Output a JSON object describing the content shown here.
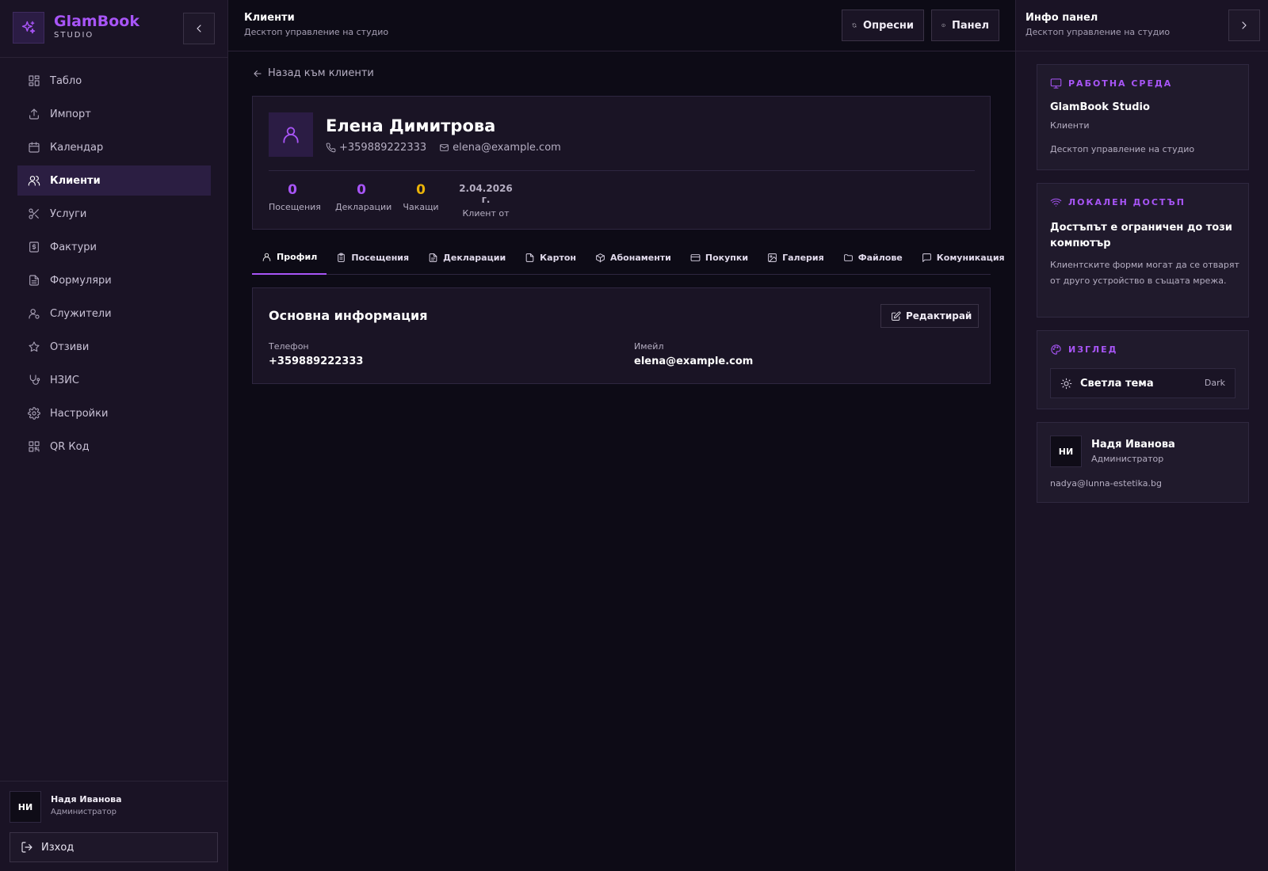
{
  "colors": {
    "accent": "#a855f7",
    "pending": "#eab308",
    "background": "#0d0b16",
    "panel": "#1a1325"
  },
  "sidebar": {
    "brand_name": "GlamBook",
    "brand_sub": "STUDIO",
    "items": [
      {
        "label": "Табло",
        "icon": "dashboard-icon"
      },
      {
        "label": "Импорт",
        "icon": "upload-icon"
      },
      {
        "label": "Календар",
        "icon": "calendar-icon"
      },
      {
        "label": "Клиенти",
        "icon": "users-icon",
        "active": true
      },
      {
        "label": "Услуги",
        "icon": "scissors-icon"
      },
      {
        "label": "Фактури",
        "icon": "invoice-icon"
      },
      {
        "label": "Формуляри",
        "icon": "form-icon"
      },
      {
        "label": "Служители",
        "icon": "staff-icon"
      },
      {
        "label": "Отзиви",
        "icon": "star-icon"
      },
      {
        "label": "НЗИС",
        "icon": "stethoscope-icon"
      },
      {
        "label": "Настройки",
        "icon": "gear-icon"
      },
      {
        "label": "QR Код",
        "icon": "qr-icon"
      }
    ],
    "user": {
      "initials": "НИ",
      "name": "Надя Иванова",
      "role": "Администратор"
    },
    "logout_label": "Изход"
  },
  "header": {
    "title": "Клиенти",
    "subtitle": "Десктоп управление на студио",
    "refresh_label": "Опресни",
    "panel_label": "Панел"
  },
  "main": {
    "back_label": "Назад към клиенти",
    "client": {
      "name": "Елена Димитрова",
      "phone": "+359889222333",
      "email": "elena@example.com",
      "stats": {
        "visits": "0",
        "visits_label": "Посещения",
        "declarations": "0",
        "declarations_label": "Декларации",
        "pending": "0",
        "pending_label": "Чакащи",
        "since": "2.04.2026 г.",
        "since_label": "Клиент от"
      }
    },
    "tabs": [
      {
        "label": "Профил",
        "icon": "user-icon",
        "active": true
      },
      {
        "label": "Посещения",
        "icon": "clipboard-icon"
      },
      {
        "label": "Декларации",
        "icon": "document-icon"
      },
      {
        "label": "Картон",
        "icon": "file-icon"
      },
      {
        "label": "Абонаменти",
        "icon": "package-icon"
      },
      {
        "label": "Покупки",
        "icon": "credit-card-icon"
      },
      {
        "label": "Галерия",
        "icon": "image-icon"
      },
      {
        "label": "Файлове",
        "icon": "folder-icon"
      },
      {
        "label": "Комуникация",
        "icon": "message-icon"
      }
    ],
    "info": {
      "title": "Основна информация",
      "edit_label": "Редактирай",
      "phone_label": "Телефон",
      "phone_value": "+359889222333",
      "email_label": "Имейл",
      "email_value": "elena@example.com"
    }
  },
  "right_panel": {
    "title": "Инфо панел",
    "subtitle": "Десктоп управление на студио",
    "workspace": {
      "heading": "РАБОТНА СРЕДА",
      "name": "GlamBook Studio",
      "section": "Клиенти",
      "description": "Десктоп управление на студио"
    },
    "local_access": {
      "heading": "ЛОКАЛЕН ДОСТЪП",
      "title": "Достъпът е ограничен до този компютър",
      "description": "Клиентските форми могат да се отварят от друго устройство в същата мрежа."
    },
    "appearance": {
      "heading": "ИЗГЛЕД",
      "toggle_label": "Светла тема",
      "toggle_value": "Dark"
    },
    "user": {
      "initials": "НИ",
      "name": "Надя Иванова",
      "role": "Администратор",
      "email": "nadya@lunna-estetika.bg"
    }
  }
}
